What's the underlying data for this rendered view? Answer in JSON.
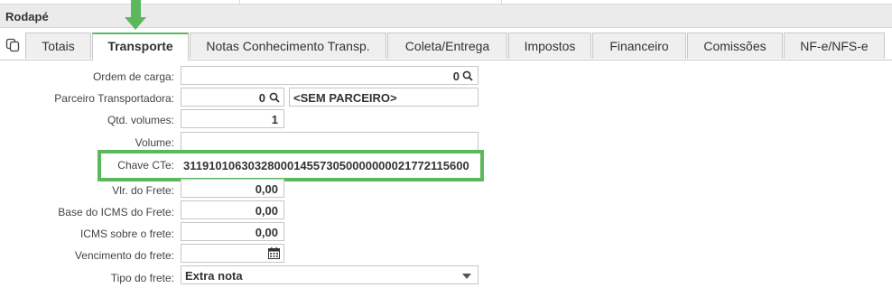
{
  "header": {
    "title": "Rodapé"
  },
  "tabs": [
    {
      "label": "Totais"
    },
    {
      "label": "Transporte",
      "active": true
    },
    {
      "label": "Notas Conhecimento Transp."
    },
    {
      "label": "Coleta/Entrega"
    },
    {
      "label": "Impostos"
    },
    {
      "label": "Financeiro"
    },
    {
      "label": "Comissões"
    },
    {
      "label": "NF-e/NFS-e"
    }
  ],
  "form": {
    "ordem_carga": {
      "label": "Ordem de carga:",
      "value": "0"
    },
    "parceiro": {
      "label": "Parceiro Transportadora:",
      "value": "0",
      "name": "<SEM PARCEIRO>"
    },
    "qtd_volumes": {
      "label": "Qtd. volumes:",
      "value": "1"
    },
    "volume": {
      "label": "Volume:",
      "value": ""
    },
    "chave_cte": {
      "label": "Chave CTe:",
      "value": "31191010630328000145573050000000021772115600"
    },
    "vlr_frete": {
      "label": "Vlr. do Frete:",
      "value": "0,00"
    },
    "base_icms": {
      "label": "Base do ICMS do Frete:",
      "value": "0,00"
    },
    "icms_frete": {
      "label": "ICMS sobre o frete:",
      "value": "0,00"
    },
    "vencimento": {
      "label": "Vencimento do frete:",
      "value": ""
    },
    "tipo_frete": {
      "label": "Tipo do frete:",
      "value": "Extra nota"
    }
  },
  "colors": {
    "highlight": "#5cb85c",
    "tab_active_border": "#5cb85c",
    "header_bg": "#ebebeb"
  },
  "icons": [
    "copy-icon",
    "search-icon",
    "calendar-icon",
    "dropdown-caret-icon",
    "down-arrow-icon"
  ]
}
